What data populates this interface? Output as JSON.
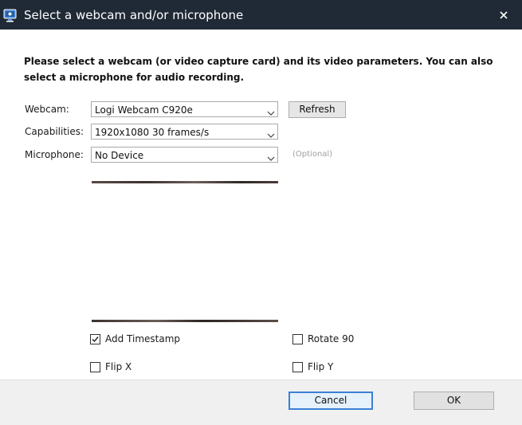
{
  "window": {
    "title": "Select a webcam and/or microphone",
    "icon": "webcam-app-icon",
    "close_icon": "close-icon"
  },
  "instructions": "Please select a webcam (or video capture card) and its video parameters. You can also select a microphone for audio recording.",
  "fields": {
    "webcam": {
      "label": "Webcam:",
      "value": "Logi Webcam C920e"
    },
    "capabilities": {
      "label": "Capabilities:",
      "value": "1920x1080 30 frames/s"
    },
    "microphone": {
      "label": "Microphone:",
      "value": "No Device",
      "hint": "(Optional)"
    }
  },
  "refresh_label": "Refresh",
  "options": {
    "add_timestamp": {
      "label": "Add Timestamp",
      "checked": true
    },
    "rotate_90": {
      "label": "Rotate 90",
      "checked": false
    },
    "flip_x": {
      "label": "Flip X",
      "checked": false
    },
    "flip_y": {
      "label": "Flip Y",
      "checked": false
    }
  },
  "footer": {
    "cancel_label": "Cancel",
    "ok_label": "OK"
  },
  "colors": {
    "titlebar": "#1f2a36",
    "focus_border": "#3b80d4"
  }
}
